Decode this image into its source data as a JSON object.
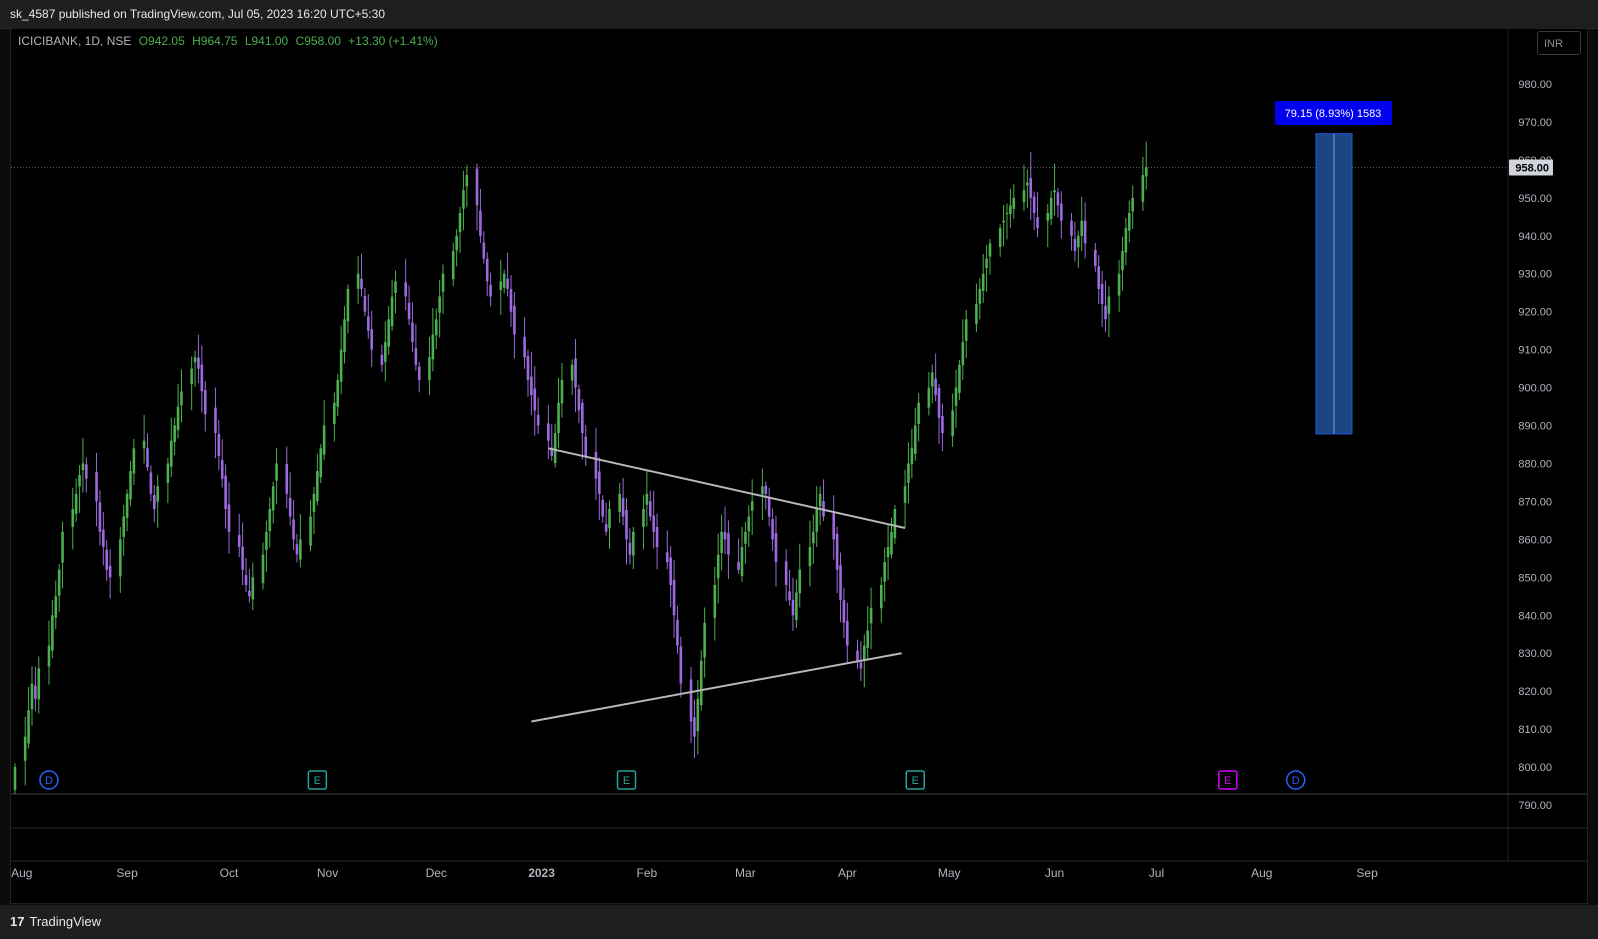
{
  "header": {
    "publish_text": "sk_4587 published on TradingView.com, Jul 05, 2023 16:20 UTC+5:30"
  },
  "legend": {
    "symbol": "ICICIBANK, 1D, NSE",
    "open": "O942.05",
    "high": "H964.75",
    "low": "L941.00",
    "close": "C958.00",
    "change": "+13.30 (+1.41%)"
  },
  "currency_button": "INR",
  "footer": {
    "brand_mark": "17",
    "brand": "TradingView"
  },
  "colors": {
    "up": "#4caf50",
    "down": "#9c6ade",
    "trendline": "#b8b8b8",
    "measure_fill": "#1e4d8c",
    "measure_label": "#0000ee"
  },
  "chart_data": {
    "type": "candlestick",
    "title": "",
    "ylim": [
      790,
      980
    ],
    "y_ticks": [
      "980.00",
      "970.00",
      "960.00",
      "950.00",
      "940.00",
      "930.00",
      "920.00",
      "910.00",
      "900.00",
      "890.00",
      "880.00",
      "870.00",
      "860.00",
      "850.00",
      "840.00",
      "830.00",
      "820.00",
      "810.00",
      "800.00",
      "790.00"
    ],
    "x_ticks": [
      "Aug",
      "Sep",
      "Oct",
      "Nov",
      "Dec",
      "2023",
      "Feb",
      "Mar",
      "Apr",
      "May",
      "Jun",
      "Jul",
      "Aug",
      "Sep"
    ],
    "last_price": "958.00",
    "measure": {
      "label": "79.15 (8.93%) 1583",
      "from": 887.8,
      "to": 966.9
    },
    "trendlines": [
      {
        "from": [
          "2023-01-02",
          884
        ],
        "to": [
          "2023-04-17",
          863
        ]
      },
      {
        "from": [
          "2022-12-28",
          812
        ],
        "to": [
          "2023-04-16",
          830
        ]
      }
    ],
    "event_markers": [
      {
        "label": "D",
        "date": "2022-08-08"
      },
      {
        "label": "E",
        "date": "2022-10-26"
      },
      {
        "label": "E",
        "date": "2023-01-25"
      },
      {
        "label": "E",
        "date": "2023-04-20"
      },
      {
        "label": "E",
        "date": "2023-07-21"
      },
      {
        "label": "D",
        "date": "2023-08-10"
      }
    ],
    "candles_daily_closes": [
      [
        800,
        808,
        815,
        822,
        818,
        826,
        832,
        840,
        845,
        852,
        862,
        868,
        872,
        877,
        880,
        876,
        870,
        862,
        858,
        852,
        850,
        860,
        866,
        872,
        878,
        884,
        886,
        879,
        872,
        868,
        874,
        880,
        886,
        890,
        895,
        899,
        905,
        908,
        905,
        899,
        893,
        888,
        882,
        876,
        868,
        862,
        858,
        852,
        848,
        845,
        850,
        856,
        862,
        868,
        874,
        880,
        872,
        866,
        860,
        856,
        860,
        866,
        872,
        878,
        884,
        890,
        896,
        902,
        910,
        918,
        926,
        930,
        926,
        920,
        915,
        910,
        906,
        912,
        918,
        924,
        928,
        924,
        918,
        912,
        906,
        902,
        908,
        914,
        918,
        924,
        930,
        936,
        940,
        946,
        952,
        956,
        948,
        940,
        934,
        928,
        924,
        928,
        930,
        926,
        920,
        914,
        908,
        902,
        898,
        894,
        890,
        886,
        882,
        888,
        896,
        902,
        906,
        900,
        894,
        888,
        882,
        876,
        872,
        866,
        862,
        868,
        872,
        866,
        860,
        856,
        862,
        868,
        872,
        866,
        862,
        858,
        854,
        848,
        840,
        832,
        822,
        812,
        808,
        818,
        828,
        838,
        848,
        856,
        862,
        860,
        856,
        852,
        858,
        862,
        866,
        870,
        874,
        872,
        866,
        860,
        854,
        848,
        844,
        840,
        846,
        852,
        858,
        862,
        868,
        872,
        866,
        860,
        852,
        844,
        838,
        832,
        828,
        826,
        832,
        836,
        842,
        848,
        854,
        858,
        862,
        868,
        874,
        880,
        884,
        890,
        896,
        900,
        904,
        898,
        892,
        888,
        894,
        900,
        906,
        912,
        918,
        922,
        926,
        930,
        934,
        938,
        942,
        944,
        946,
        948,
        950,
        952,
        954,
        950,
        946,
        942,
        946,
        950,
        952,
        948,
        944,
        940,
        936,
        940,
        944,
        938,
        932,
        926,
        922,
        918,
        924,
        930,
        936,
        942,
        946,
        950,
        956,
        958
      ]
    ]
  }
}
